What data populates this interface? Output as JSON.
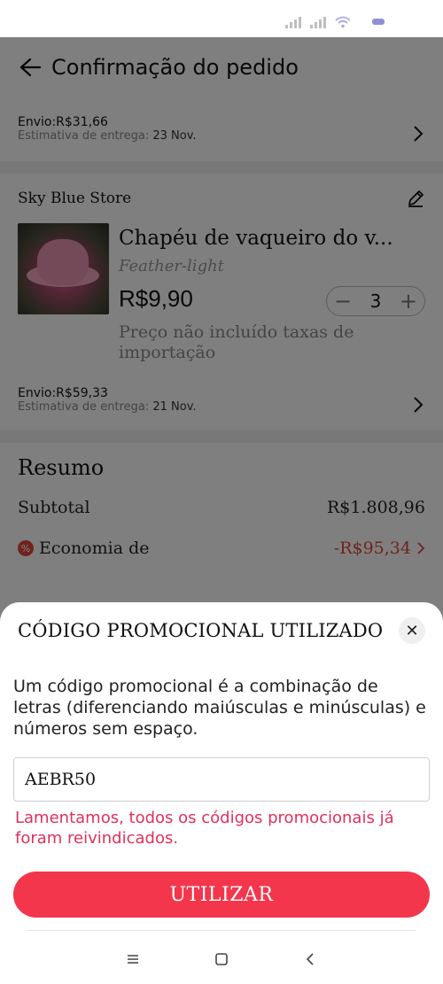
{
  "header": {
    "title": "Confirmação do pedido"
  },
  "shipping_top": {
    "price": "Envio:R$31,66",
    "estimate_label": "Estimativa de entrega:",
    "estimate_date": "23 Nov."
  },
  "store": {
    "name": "Sky Blue Store"
  },
  "product": {
    "title": "Chapéu de vaqueiro do v...",
    "variant": "Feather-light",
    "price": "R$9,90",
    "quantity": "3",
    "note": "Preço não incluído taxas de importação"
  },
  "shipping_item": {
    "price": "Envio:R$59,33",
    "estimate_label": "Estimativa de entrega:",
    "estimate_date": "21 Nov."
  },
  "summary": {
    "title": "Resumo",
    "subtotal_label": "Subtotal",
    "subtotal_value": "R$1.808,96",
    "savings_label": "Economia de",
    "savings_value": "-R$95,34"
  },
  "promo_sheet": {
    "title": "CÓDIGO PROMOCIONAL UTILIZADO",
    "description": "Um código promocional é a combinação de letras (diferenciando maiúsculas e minúsculas) e números sem espaço.",
    "input_value": "AEBR50",
    "error": "Lamentamos, todos os códigos promocionais já foram reivindicados.",
    "apply_label": "UTILIZAR"
  },
  "colors": {
    "accent": "#f4364c",
    "error": "#e0305c",
    "savings": "#e0473c"
  }
}
